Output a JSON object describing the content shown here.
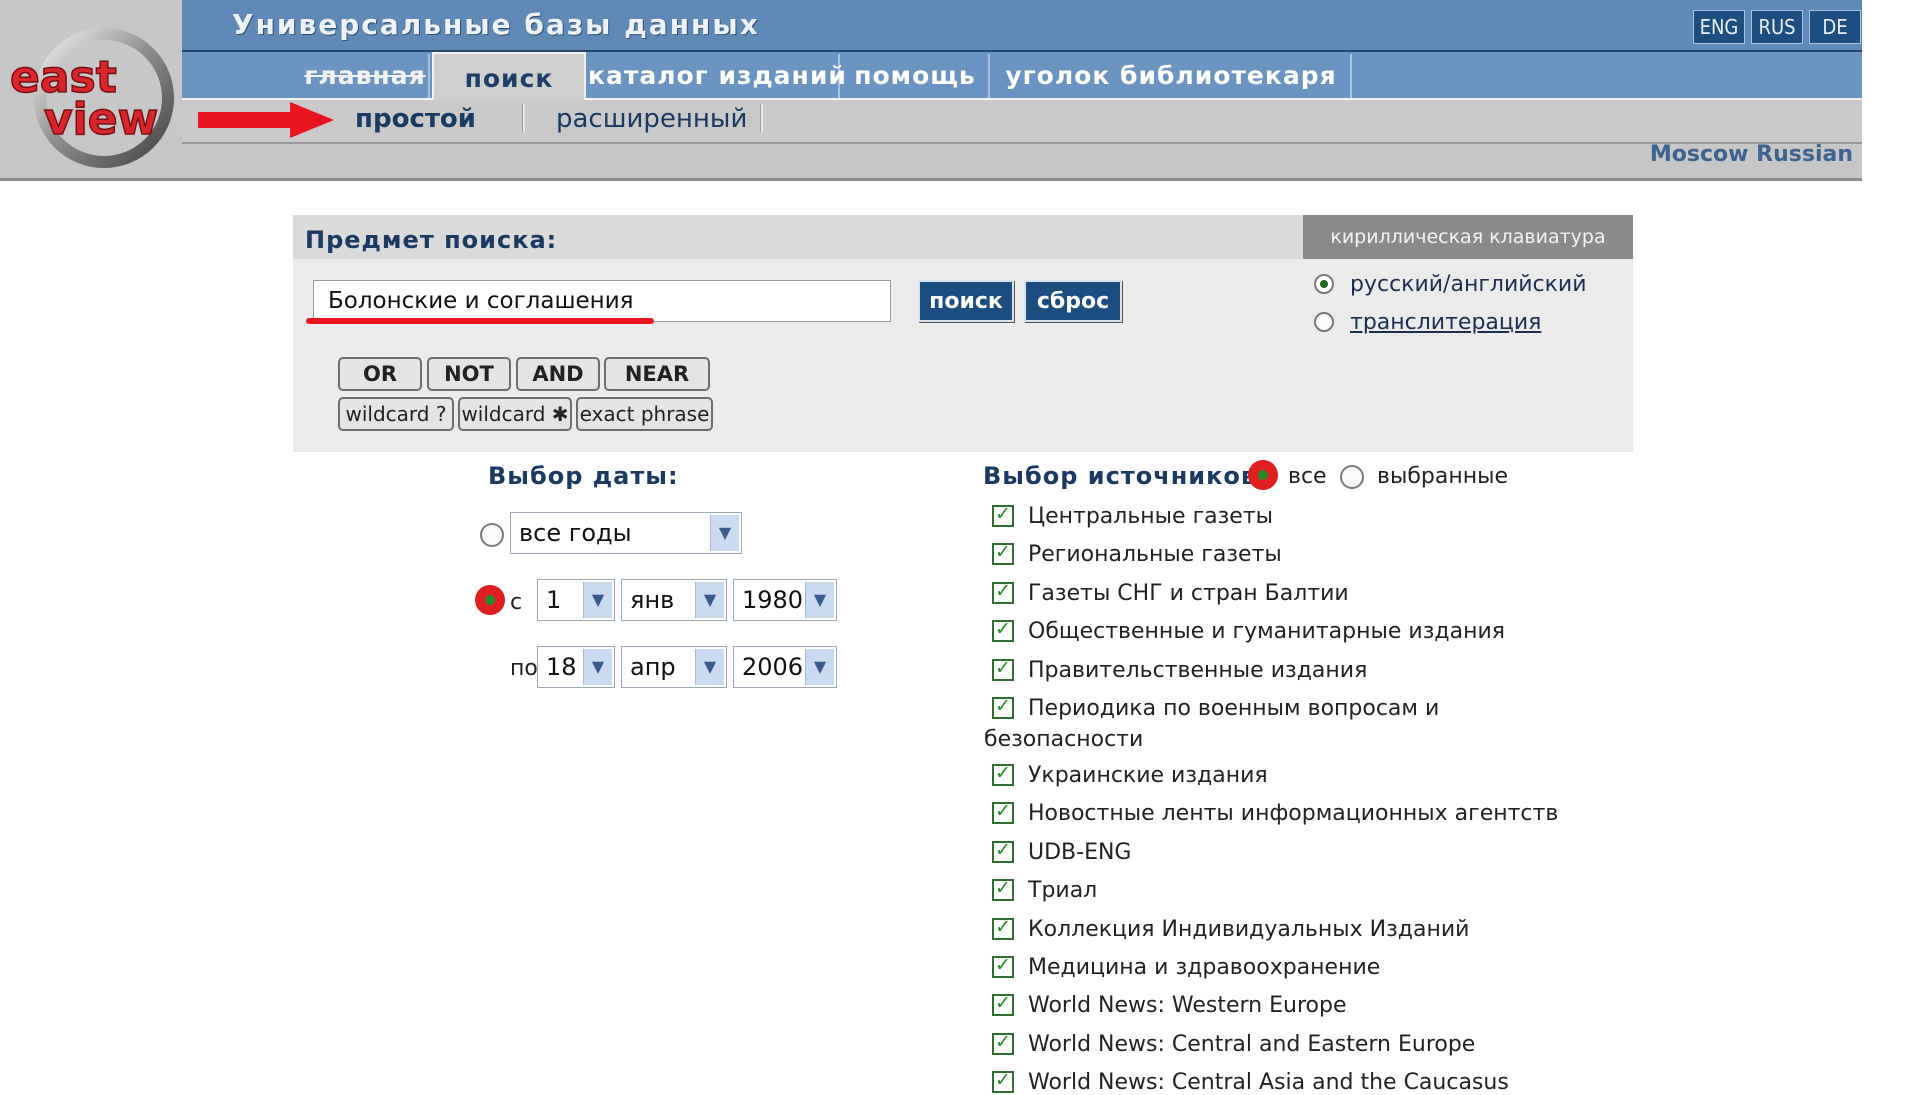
{
  "header": {
    "title": "Универсальные базы данных",
    "languages": [
      "ENG",
      "RUS",
      "DE"
    ],
    "tabs": [
      {
        "label": "главная"
      },
      {
        "label": "поиск"
      },
      {
        "label": "каталог изданий"
      },
      {
        "label": "помощь"
      },
      {
        "label": "уголок библиотекаря"
      }
    ],
    "subtabs": [
      {
        "label": "простой"
      },
      {
        "label": "расширенный"
      }
    ],
    "region": "Moscow Russian",
    "logo_top": "east",
    "logo_bottom": "view"
  },
  "search": {
    "label": "Предмет поиска:",
    "query": "Болонские и соглашения",
    "search_button": "поиск",
    "reset_button": "сброс",
    "operators": [
      "OR",
      "NOT",
      "AND",
      "NEAR"
    ],
    "wildcards": [
      "wildcard ?",
      "wildcard ✱",
      "exact phrase"
    ]
  },
  "keyboard": {
    "title": "кириллическая клавиатура",
    "options": [
      "русский/английский",
      "транслитерация"
    ],
    "selected": "русский/английский"
  },
  "dates": {
    "title": "Выбор даты:",
    "all_years": "все годы",
    "from_label": "с",
    "from_day": "1",
    "from_month": "янв",
    "from_year": "1980",
    "to_label": "по",
    "to_day": "18",
    "to_month": "апр",
    "to_year": "2006"
  },
  "sources": {
    "title": "Выбор источников:",
    "option_all": "все",
    "option_selected": "выбранные",
    "items": [
      "Центральные газеты",
      "Региональные газеты",
      "Газеты СНГ и стран Балтии",
      "Общественные и гуманитарные издания",
      "Правительственные издания",
      "Периодика по военным вопросам и",
      "Украинские издания",
      "Новостные ленты информационных агентств",
      "UDB-ENG",
      "Триал",
      "Коллекция Индивидуальных Изданий",
      "Медицина и здравоохранение",
      "World News: Western Europe",
      "World News: Central and Eastern Europe",
      "World News: Central Asia and the Caucasus"
    ],
    "item_6_continuation": "безопасности"
  },
  "colors": {
    "accent": "#1c4d80",
    "header_band": "#5f8ab7",
    "highlight_red": "#e8141e"
  }
}
